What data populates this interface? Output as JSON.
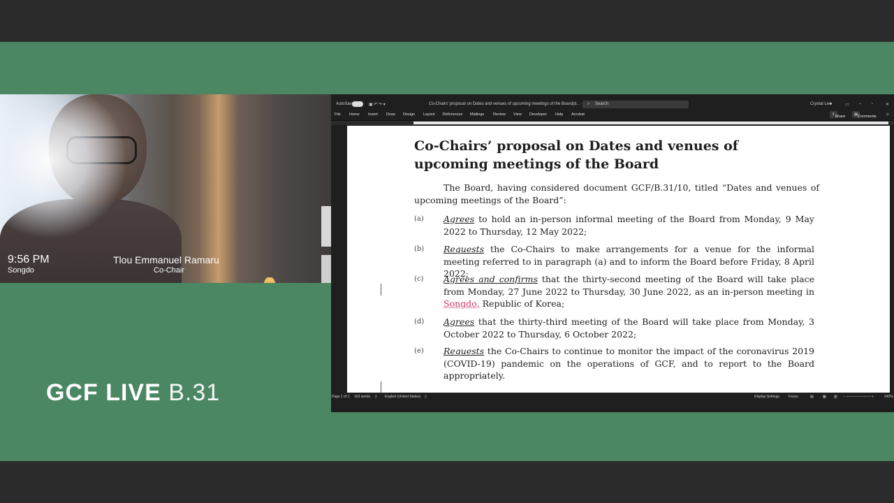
{
  "meeting": {
    "time": "9:56 PM",
    "location": "Songdo",
    "participant_name": "Tlou Emmanuel Ramaru",
    "participant_role": "Co-Chair",
    "brand_bold": "GCF LIVE",
    "brand_light": "B.31"
  },
  "word": {
    "autosave_label": "AutoSave",
    "doc_title": "Co-Chairs' proposal on Dates and venues of upcoming meetings of the Board(d... · Saved ˅",
    "search_placeholder": "Search",
    "user_name": "Crystal Lee",
    "tabs": [
      "File",
      "Home",
      "Insert",
      "Draw",
      "Design",
      "Layout",
      "References",
      "Mailings",
      "Review",
      "View",
      "Developer",
      "Help",
      "Acrobat"
    ],
    "share_label": "Share",
    "comments_label": "Comments",
    "status": {
      "page": "Page 1 of 1",
      "words": "163 words",
      "language": "English (United States)",
      "display_settings": "Display Settings",
      "focus": "Focus",
      "zoom": "240%"
    }
  },
  "document": {
    "heading": "Co-Chairs’ proposal on Dates and venues of upcoming meetings of the Board",
    "intro": "The Board, having considered document GCF/B.31/10, titled “Dates and venues of upcoming meetings of the Board”:",
    "items": [
      {
        "label": "(a)",
        "verb": "Agrees",
        "text": " to hold an in-person informal meeting of the Board from Monday, 9 May 2022 to Thursday, 12 May 2022;"
      },
      {
        "label": "(b)",
        "verb": "Requests",
        "text": " the Co-Chairs to make arrangements for a venue for the informal meeting referred to in paragraph (a) and to inform the Board before Friday, 8 April 2022;"
      },
      {
        "label": "(c)",
        "verb": "Agrees and confirms",
        "text_before": " that the thirty-second meeting of the Board will take place from Monday, 27 June 2022 to Thursday, 30 June 2022, as an in-person meeting in ",
        "highlight": "Songdo,",
        "text_after": " Republic of Korea;"
      },
      {
        "label": "(d)",
        "verb": "Agrees",
        "text": " that the thirty-third meeting of the Board will take place from Monday, 3 October 2022 to Thursday, 6 October 2022;"
      },
      {
        "label": "(e)",
        "verb": "Requests",
        "text": " the Co-Chairs to continue to monitor the impact of the coronavirus 2019 (COVID-19) pandemic on the operations of GCF, and to report to the Board appropriately."
      }
    ]
  }
}
